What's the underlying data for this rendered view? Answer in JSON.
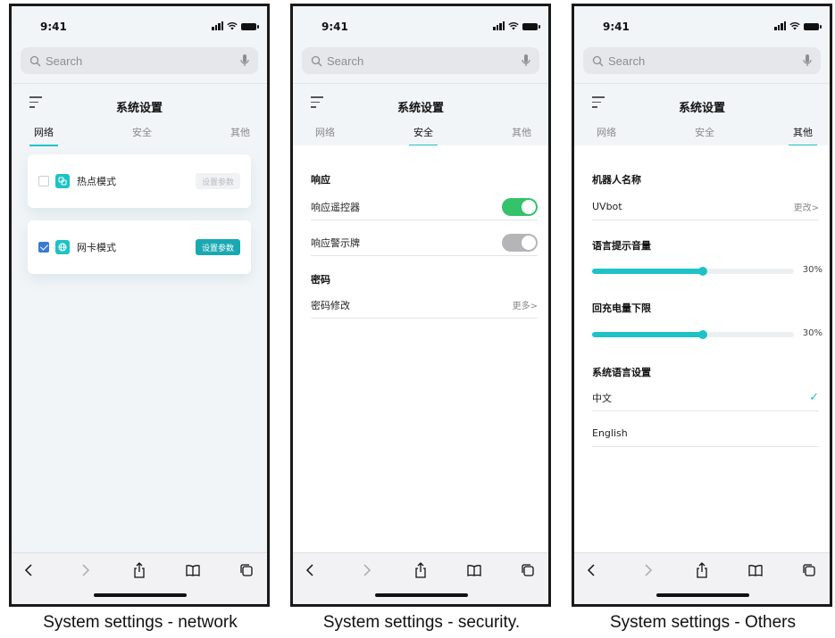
{
  "status_time": "9:41",
  "search_placeholder": "Search",
  "header_title": "系统设置",
  "tabs": [
    "网络",
    "安全",
    "其他"
  ],
  "screen_network": {
    "items": [
      {
        "label": "热点模式",
        "checked": false,
        "button": "设置参数",
        "button_enabled": false
      },
      {
        "label": "网卡模式",
        "checked": true,
        "button": "设置参数",
        "button_enabled": true
      }
    ]
  },
  "screen_security": {
    "section_response": "响应",
    "remote_label": "响应遥控器",
    "remote_on": true,
    "alarm_label": "响应警示牌",
    "alarm_on": false,
    "section_password": "密码",
    "password_change": "密码修改",
    "more": "更多>"
  },
  "screen_others": {
    "robot_name_title": "机器人名称",
    "robot_name": "UVbot",
    "change": "更改>",
    "voice_volume_title": "语言提示音量",
    "voice_volume": "30%",
    "voice_volume_level": 0.55,
    "recharge_title": "回充电量下限",
    "recharge": "30%",
    "recharge_level": 0.55,
    "language_title": "系统语言设置",
    "languages": [
      "中文",
      "English"
    ],
    "selected_language": "中文"
  },
  "captions": [
    "System settings - network",
    "System settings - security.",
    "System settings - Others"
  ],
  "colors": {
    "accent": "#1ec2c6",
    "toggle_on": "#34c26a",
    "toggle_off": "#b5b5b7"
  }
}
